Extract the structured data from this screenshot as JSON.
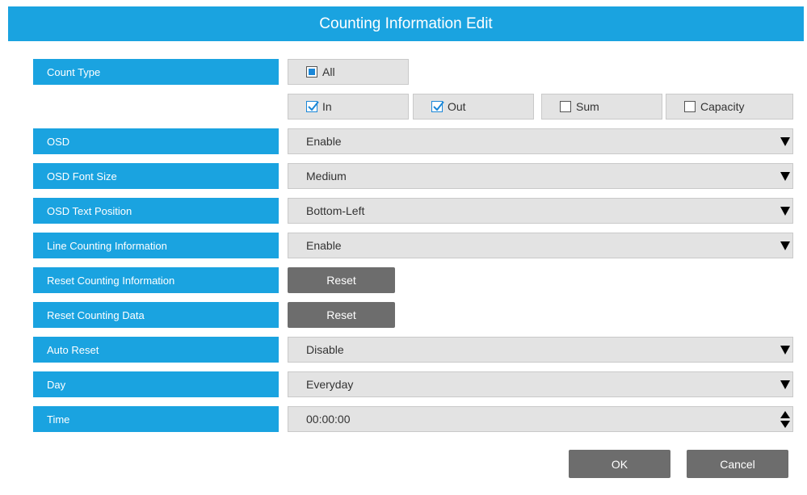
{
  "dialog": {
    "title": "Counting Information Edit"
  },
  "count_type": {
    "label": "Count Type",
    "all": {
      "label": "All",
      "state": "partial"
    },
    "options": [
      {
        "label": "In",
        "checked": true
      },
      {
        "label": "Out",
        "checked": true
      },
      {
        "label": "Sum",
        "checked": false
      },
      {
        "label": "Capacity",
        "checked": false
      }
    ]
  },
  "osd": {
    "label": "OSD",
    "value": "Enable"
  },
  "osd_font_size": {
    "label": "OSD Font Size",
    "value": "Medium"
  },
  "osd_text_position": {
    "label": "OSD Text Position",
    "value": "Bottom-Left"
  },
  "line_counting_info": {
    "label": "Line Counting Information",
    "value": "Enable"
  },
  "reset_counting_info": {
    "label": "Reset Counting Information",
    "button": "Reset"
  },
  "reset_counting_data": {
    "label": "Reset Counting Data",
    "button": "Reset"
  },
  "auto_reset": {
    "label": "Auto Reset",
    "value": "Disable"
  },
  "day": {
    "label": "Day",
    "value": "Everyday"
  },
  "time": {
    "label": "Time",
    "value": "00:00:00"
  },
  "footer": {
    "ok": "OK",
    "cancel": "Cancel"
  },
  "colors": {
    "accent": "#1aa3e0",
    "button": "#6d6d6d",
    "field": "#e3e3e3",
    "check": "#1a87d8"
  },
  "icons": {
    "dropdown": "triangle-down",
    "spinner": "up-down-triangles",
    "check": "checkmark"
  }
}
